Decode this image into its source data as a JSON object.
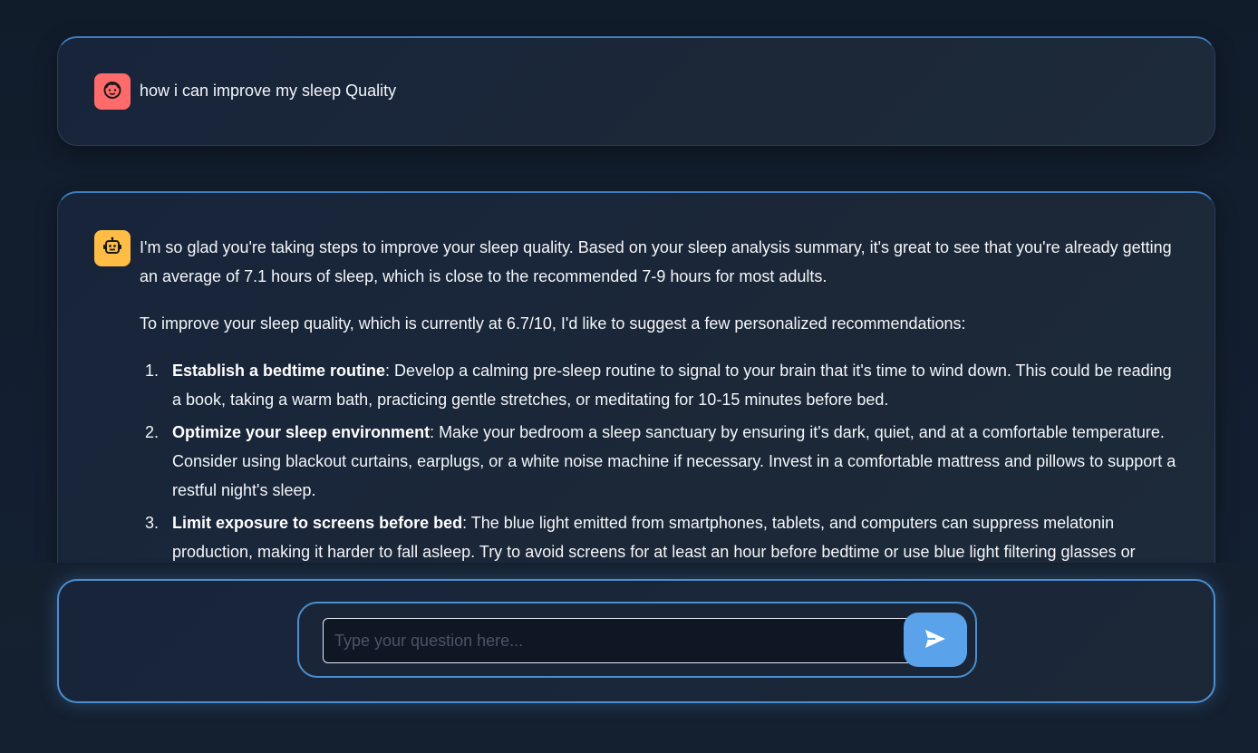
{
  "conversation": {
    "user_message": {
      "avatar_icon": "user-face-icon",
      "avatar_color": "#ff6b6b",
      "text": "how i can improve my sleep Quality"
    },
    "bot_message": {
      "avatar_icon": "robot-icon",
      "avatar_color": "#ffbd45",
      "paragraph_1": "I'm so glad you're taking steps to improve your sleep quality. Based on your sleep analysis summary, it's great to see that you're already getting an average of 7.1 hours of sleep, which is close to the recommended 7-9 hours for most adults.",
      "paragraph_2": "To improve your sleep quality, which is currently at 6.7/10, I'd like to suggest a few personalized recommendations:",
      "items": [
        {
          "number": "1.",
          "title": "Establish a bedtime routine",
          "text": ": Develop a calming pre-sleep routine to signal to your brain that it's time to wind down. This could be reading a book, taking a warm bath, practicing gentle stretches, or meditating for 10-15 minutes before bed."
        },
        {
          "number": "2.",
          "title": "Optimize your sleep environment",
          "text": ": Make your bedroom a sleep sanctuary by ensuring it's dark, quiet, and at a comfortable temperature. Consider using blackout curtains, earplugs, or a white noise machine if necessary. Invest in a comfortable mattress and pillows to support a restful night's sleep."
        },
        {
          "number": "3.",
          "title": "Limit exposure to screens before bed",
          "text": ": The blue light emitted from smartphones, tablets, and computers can suppress melatonin production, making it harder to fall asleep. Try to avoid screens for at least an hour before bedtime or use blue light filtering glasses or"
        }
      ]
    }
  },
  "composer": {
    "placeholder": "Type your question here...",
    "value": "",
    "send_icon": "send-icon",
    "accent_color": "#5aa2ea"
  }
}
